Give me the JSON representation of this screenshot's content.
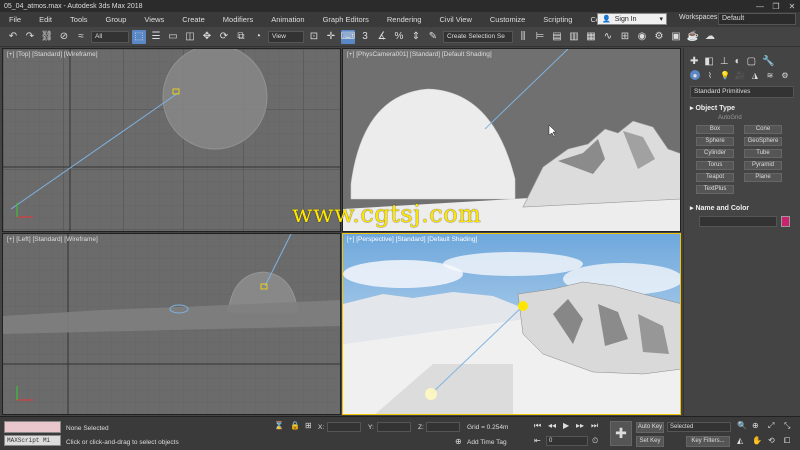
{
  "window": {
    "title": "05_04_atmos.max - Autodesk 3ds Max 2018",
    "controls": [
      "—",
      "❐",
      "✕"
    ]
  },
  "menu": {
    "items": [
      "File",
      "Edit",
      "Tools",
      "Group",
      "Views",
      "Create",
      "Modifiers",
      "Animation",
      "Graph Editors",
      "Rendering",
      "Civil View",
      "Customize",
      "Scripting",
      "Content"
    ],
    "sign_in": "Sign In",
    "workspaces_label": "Workspaces:",
    "workspaces_value": "Default"
  },
  "toolbar": {
    "filter_value": "All",
    "coord_value": "View",
    "selection_set_placeholder": "Create Selection Se"
  },
  "viewports": {
    "top": {
      "label": "[+] [Top] [Standard] [Wireframe]"
    },
    "camera": {
      "label": "[+] [PhysCamera001] [Standard] [Default Shading]"
    },
    "left": {
      "label": "[+] [Left] [Standard] [Wireframe]"
    },
    "perspective": {
      "label": "[+] [Perspective] [Standard] [Default Shading]"
    }
  },
  "command_panel": {
    "category": "Standard Primitives",
    "object_type_title": "Object Type",
    "autogrid": "AutoGrid",
    "buttons": [
      "Box",
      "Cone",
      "Sphere",
      "GeoSphere",
      "Cylinder",
      "Tube",
      "Torus",
      "Pyramid",
      "Teapot",
      "Plane",
      "TextPlus"
    ],
    "name_color_title": "Name and Color",
    "object_color": "#c8236f"
  },
  "status": {
    "maxscript": "MAXScript Mi",
    "selection": "None Selected",
    "prompt": "Click or click-and-drag to select objects",
    "x_label": "X:",
    "y_label": "Y:",
    "z_label": "Z:",
    "grid": "Grid = 0.254m",
    "add_time_tag": "Add Time Tag",
    "frame_value": "0",
    "auto_key": "Auto Key",
    "set_key": "Set Key",
    "key_mode": "Selected",
    "key_filters": "Key Filters..."
  },
  "watermark": "www.cgtsj.com"
}
